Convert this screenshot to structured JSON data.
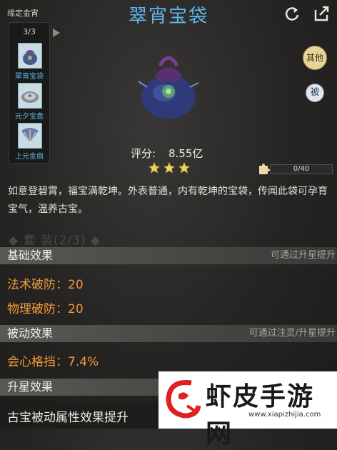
{
  "set": {
    "label": "缘定金宵",
    "count": "3/3",
    "items": [
      {
        "name": "翠宵宝袋",
        "icon": "pouch-icon"
      },
      {
        "name": "元夕宝盘",
        "icon": "plate-icon"
      },
      {
        "name": "上元金扇",
        "icon": "fan-icon"
      }
    ]
  },
  "header": {
    "title": "翠宵宝袋",
    "refresh_icon": "refresh-icon",
    "share_icon": "share-icon"
  },
  "badges": {
    "qi": "其他",
    "bei": "被"
  },
  "item": {
    "score_label": "评分:",
    "score_value": "8.55亿",
    "stars": 3,
    "progress_text": "0/40",
    "progress_value": 0,
    "description": "如意登碧霄，福宝满乾坤。外表普通，内有乾坤的宝袋，传闻此袋可孕育宝气，温养古宝。"
  },
  "faded_text": "◆ 套 装(2/3) ◆",
  "sections": {
    "basic": {
      "title": "基础效果",
      "hint": "可通过升星提升"
    },
    "passive": {
      "title": "被动效果",
      "hint": "可通过注灵/升星提升"
    },
    "upgrade": {
      "title": "升星效果"
    }
  },
  "stats": {
    "magic_pen": "法术破防：20",
    "phys_pen": "物理破防：20",
    "crit_block": "会心格挡：7.4%"
  },
  "bottom_text": "古宝被动属性效果提升",
  "watermark": {
    "brand": "虾皮手游网",
    "url": "www.xiapizhijia.com"
  },
  "colors": {
    "title": "#5fb6e8",
    "stat": "#f29a3a",
    "set_name": "#5fb0e0"
  }
}
